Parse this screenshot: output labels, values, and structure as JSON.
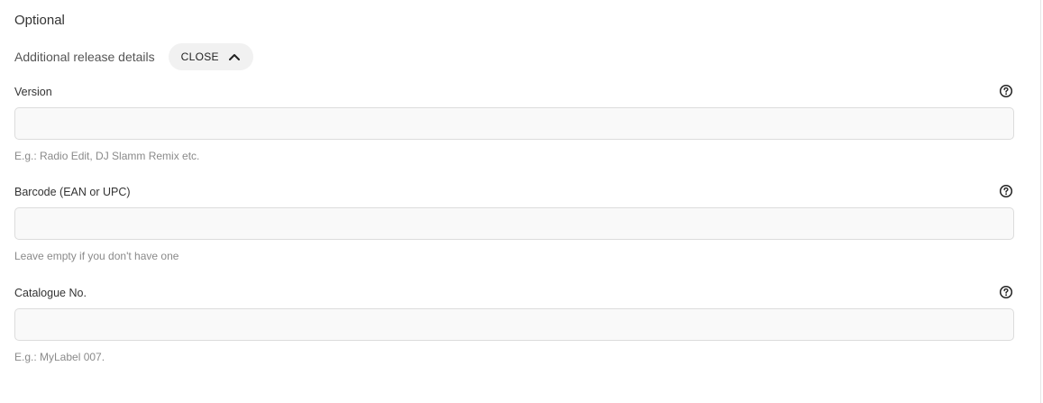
{
  "section": {
    "title": "Optional"
  },
  "details": {
    "label": "Additional release details",
    "toggle_label": "CLOSE",
    "toggle_icon": "chevron-up-icon"
  },
  "fields": [
    {
      "label": "Version",
      "value": "",
      "placeholder": "",
      "hint": "E.g.: Radio Edit, DJ Slamm Remix etc.",
      "help_icon": "question-circle-icon"
    },
    {
      "label": "Barcode (EAN or UPC)",
      "value": "",
      "placeholder": "",
      "hint": "Leave empty if you don't have one",
      "help_icon": "question-circle-icon"
    },
    {
      "label": "Catalogue No.",
      "value": "",
      "placeholder": "",
      "hint": "E.g.: MyLabel 007.",
      "help_icon": "question-circle-icon"
    }
  ],
  "colors": {
    "input_background": "#f9f9f9",
    "input_border": "#dcdcdc",
    "chip_background": "#f1f1f1",
    "hint_text": "#8a8a8a"
  }
}
